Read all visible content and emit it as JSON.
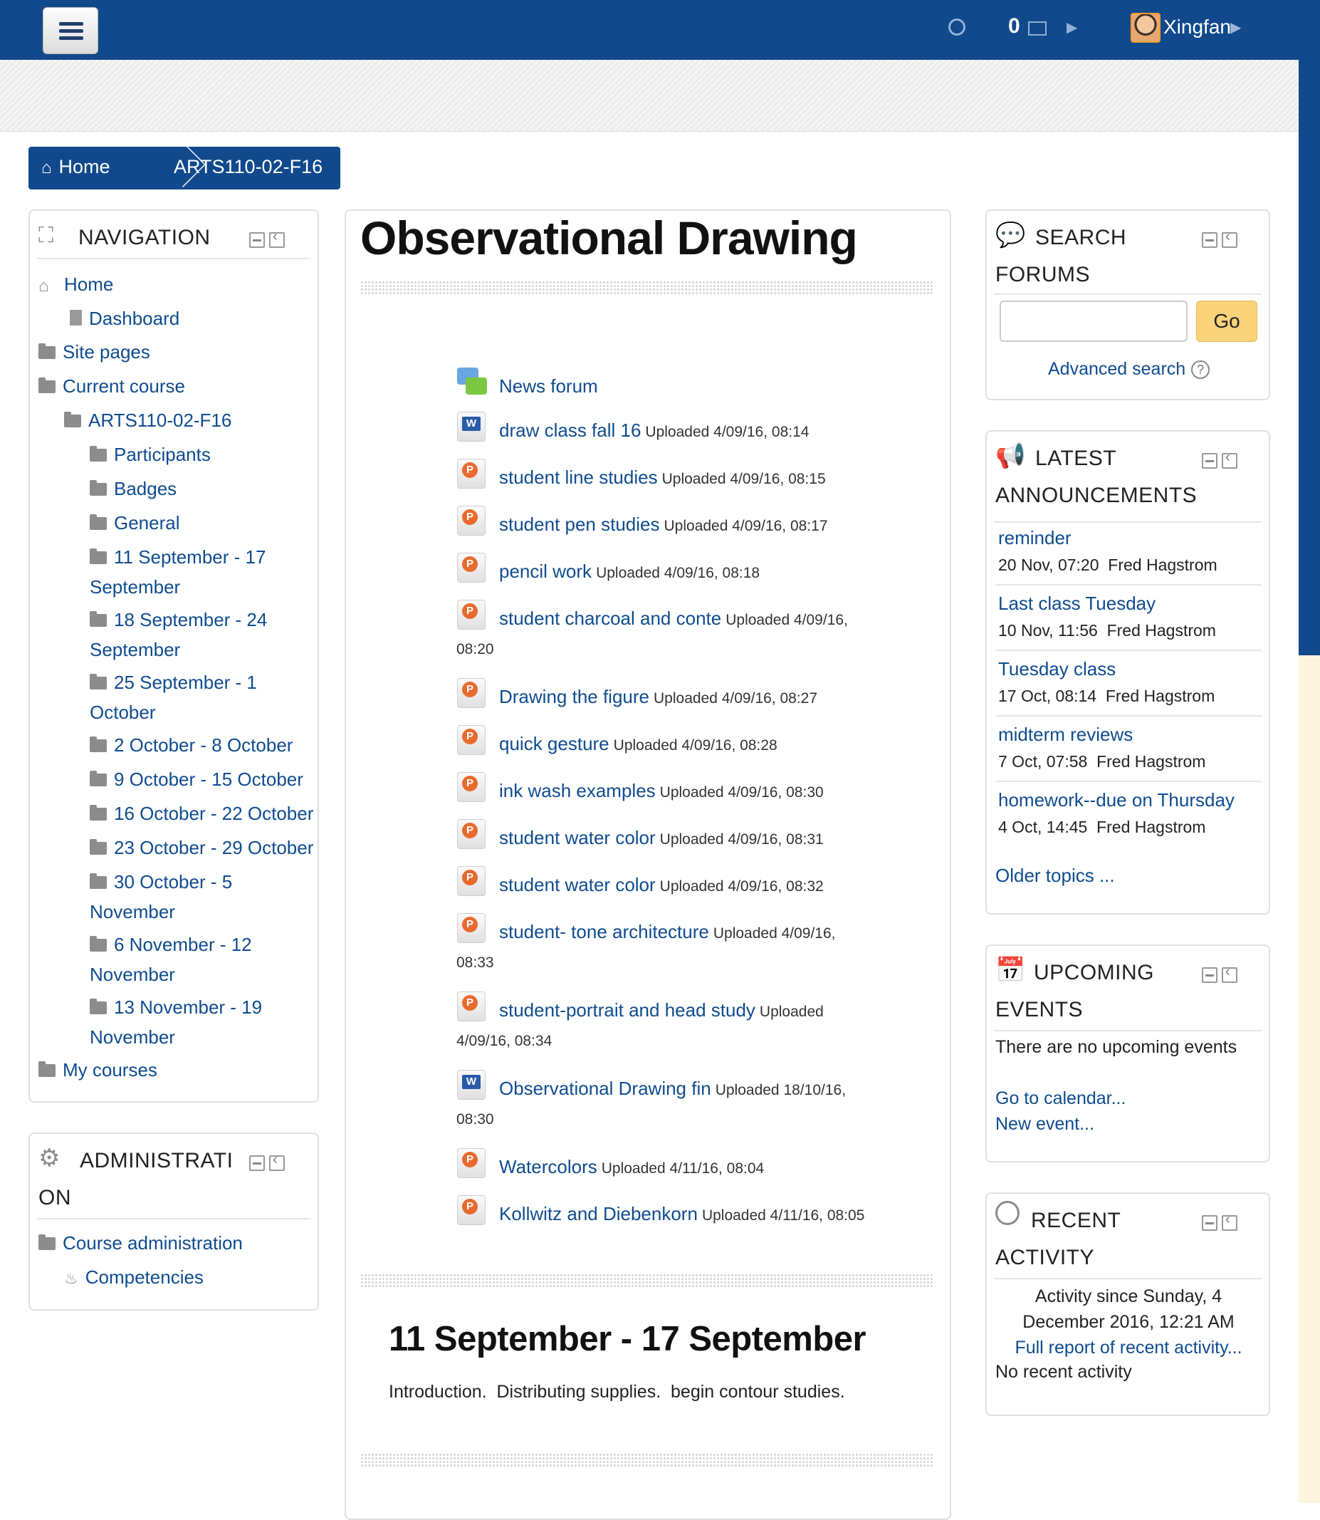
{
  "topbar": {
    "message_count": "0",
    "user_name": "Xingfan"
  },
  "breadcrumb": {
    "home": "Home",
    "course": "ARTS110-02-F16"
  },
  "navigation": {
    "title": "NAVIGATION",
    "items": {
      "home": "Home",
      "dashboard": "Dashboard",
      "site_pages": "Site pages",
      "current_course": "Current course",
      "course": "ARTS110-02-F16",
      "participants": "Participants",
      "badges": "Badges",
      "general": "General",
      "w1a": "11 September - 17",
      "w1b": "September",
      "w2a": "18 September - 24",
      "w2b": "September",
      "w3a": "25 September - 1",
      "w3b": "October",
      "w4": "2 October - 8 October",
      "w5": "9 October - 15 October",
      "w6": "16 October - 22 October",
      "w7": "23 October - 29 October",
      "w8a": "30 October - 5",
      "w8b": "November",
      "w9a": "6 November - 12",
      "w9b": "November",
      "w10a": "13 November - 19",
      "w10b": "November",
      "my_courses": "My courses"
    }
  },
  "administration": {
    "title_a": "ADMINISTRATI",
    "title_b": "ON",
    "course_admin": "Course administration",
    "competencies": "Competencies"
  },
  "main": {
    "title": "Observational Drawing",
    "resources": [
      {
        "name": "News forum",
        "meta": "",
        "type": "forum"
      },
      {
        "name": "draw class fall 16",
        "meta": "Uploaded 4/09/16, 08:14",
        "type": "word"
      },
      {
        "name": "student line studies",
        "meta": "Uploaded 4/09/16, 08:15",
        "type": "ppt"
      },
      {
        "name": "student pen studies",
        "meta": "Uploaded 4/09/16, 08:17",
        "type": "ppt"
      },
      {
        "name": "pencil work",
        "meta": "Uploaded 4/09/16, 08:18",
        "type": "ppt"
      },
      {
        "name": "student charcoal and conte",
        "meta": "Uploaded 4/09/16,",
        "meta2": "08:20",
        "type": "ppt"
      },
      {
        "name": "Drawing the figure",
        "meta": "Uploaded 4/09/16, 08:27",
        "type": "ppt"
      },
      {
        "name": "quick gesture",
        "meta": "Uploaded 4/09/16, 08:28",
        "type": "ppt"
      },
      {
        "name": "ink wash examples",
        "meta": "Uploaded 4/09/16, 08:30",
        "type": "ppt"
      },
      {
        "name": "student water color",
        "meta": "Uploaded 4/09/16, 08:31",
        "type": "ppt"
      },
      {
        "name": "student water color",
        "meta": "Uploaded 4/09/16, 08:32",
        "type": "ppt"
      },
      {
        "name": "student- tone architecture",
        "meta": "Uploaded 4/09/16,",
        "meta2": "08:33",
        "type": "ppt"
      },
      {
        "name": "student-portrait and head study",
        "meta": "Uploaded",
        "meta2": "4/09/16, 08:34",
        "type": "ppt"
      },
      {
        "name": "Observational Drawing fin",
        "meta": "Uploaded 18/10/16,",
        "meta2": "08:30",
        "type": "word"
      },
      {
        "name": "Watercolors",
        "meta": "Uploaded 4/11/16, 08:04",
        "type": "ppt"
      },
      {
        "name": "Kollwitz and Diebenkorn",
        "meta": "Uploaded 4/11/16, 08:05",
        "type": "ppt"
      }
    ],
    "section_title": "11 September - 17 September",
    "section_summary": "Introduction.  Distributing supplies.  begin contour studies."
  },
  "search_forums": {
    "title_a": "SEARCH",
    "title_b": "FORUMS",
    "input_value": "",
    "go_label": "Go",
    "advanced": "Advanced search"
  },
  "announcements": {
    "title_a": "LATEST",
    "title_b": "ANNOUNCEMENTS",
    "posts": [
      {
        "title": "reminder",
        "meta": "20 Nov, 07:20  Fred Hagstrom"
      },
      {
        "title": "Last class Tuesday",
        "meta": "10 Nov, 11:56  Fred Hagstrom"
      },
      {
        "title": "Tuesday class",
        "meta": "17 Oct, 08:14  Fred Hagstrom"
      },
      {
        "title": "midterm reviews",
        "meta": "7 Oct, 07:58  Fred Hagstrom"
      },
      {
        "title": "homework--due on Thursday",
        "meta": "4 Oct, 14:45  Fred Hagstrom"
      }
    ],
    "older": "Older topics ..."
  },
  "events": {
    "title_a": "UPCOMING",
    "title_b": "EVENTS",
    "none": "There are no upcoming events",
    "calendar": "Go to calendar...",
    "new_event": "New event..."
  },
  "recent": {
    "title_a": "RECENT",
    "title_b": "ACTIVITY",
    "since_a": "Activity since Sunday, 4",
    "since_b": "December 2016, 12:21 AM",
    "full_report": "Full report of recent activity...",
    "none": "No recent activity"
  },
  "colors": {
    "brand": "#11498c",
    "link": "#0f4c8f",
    "go_button": "#f9d27a"
  }
}
